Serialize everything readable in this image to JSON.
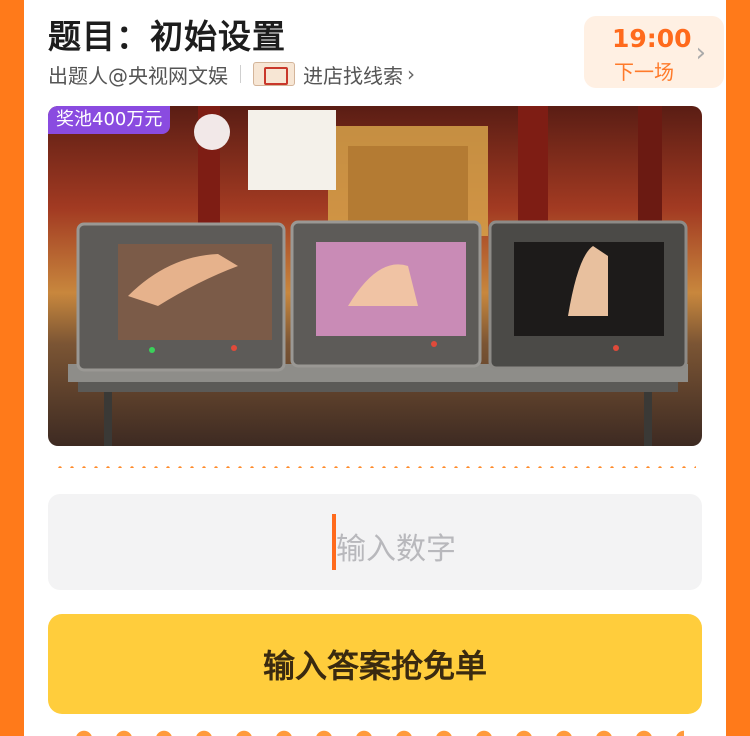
{
  "header": {
    "title": "题目：初始设置",
    "author": "出题人@央视网文娱",
    "shop_link": "进店找线索",
    "shop_chevron": "›"
  },
  "timer": {
    "time": "19:00",
    "label": "下一场",
    "chevron": "›"
  },
  "banner": {
    "badge": "奖池400万元",
    "colors": {
      "badge_bg": "#8a4be0"
    }
  },
  "answer": {
    "placeholder": "输入数字"
  },
  "submit": {
    "label": "输入答案抢免单"
  },
  "icons": [
    "shop-logo-icon",
    "chevron-right-icon"
  ],
  "colors": {
    "frame": "#ff7a1a",
    "accent": "#ff6a1c",
    "button": "#ffcd3c",
    "input_bg": "#f3f3f4"
  }
}
